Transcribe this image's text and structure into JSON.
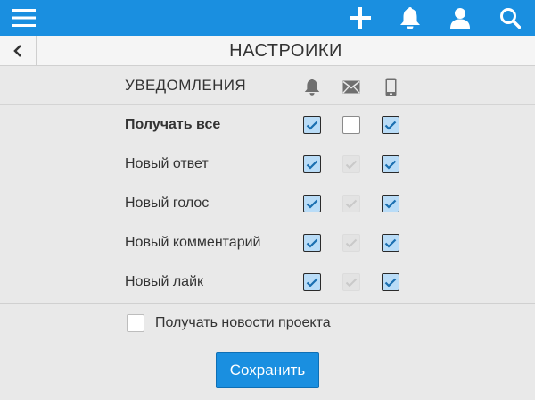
{
  "topbar": {
    "icons": [
      "menu-icon",
      "plus-icon",
      "bell-icon",
      "user-icon",
      "search-icon"
    ],
    "background": "#1a8fe0"
  },
  "titlebar": {
    "title": "НАСТРОИКИ",
    "back_icon": "chevron-left-icon"
  },
  "notifications": {
    "section_title": "УВЕДОМЛЕНИЯ",
    "columns": [
      "bell-icon",
      "mail-icon",
      "phone-icon"
    ],
    "rows": [
      {
        "label": "Получать все",
        "bold": true,
        "states": [
          "checked",
          "unchecked",
          "checked"
        ]
      },
      {
        "label": "Новый ответ",
        "bold": false,
        "states": [
          "checked",
          "disabled",
          "checked"
        ]
      },
      {
        "label": "Новый голос",
        "bold": false,
        "states": [
          "checked",
          "disabled",
          "checked"
        ]
      },
      {
        "label": "Новый комментарий",
        "bold": false,
        "states": [
          "checked",
          "disabled",
          "checked"
        ]
      },
      {
        "label": "Новый лайк",
        "bold": false,
        "states": [
          "checked",
          "disabled",
          "checked"
        ]
      }
    ]
  },
  "news": {
    "label": "Получать новости проекта",
    "checked": false
  },
  "save_button": {
    "label": "Сохранить"
  },
  "colors": {
    "accent": "#1a8fe0",
    "checked_fill": "#b9dcf7",
    "check_mark": "#1a6fb0"
  }
}
